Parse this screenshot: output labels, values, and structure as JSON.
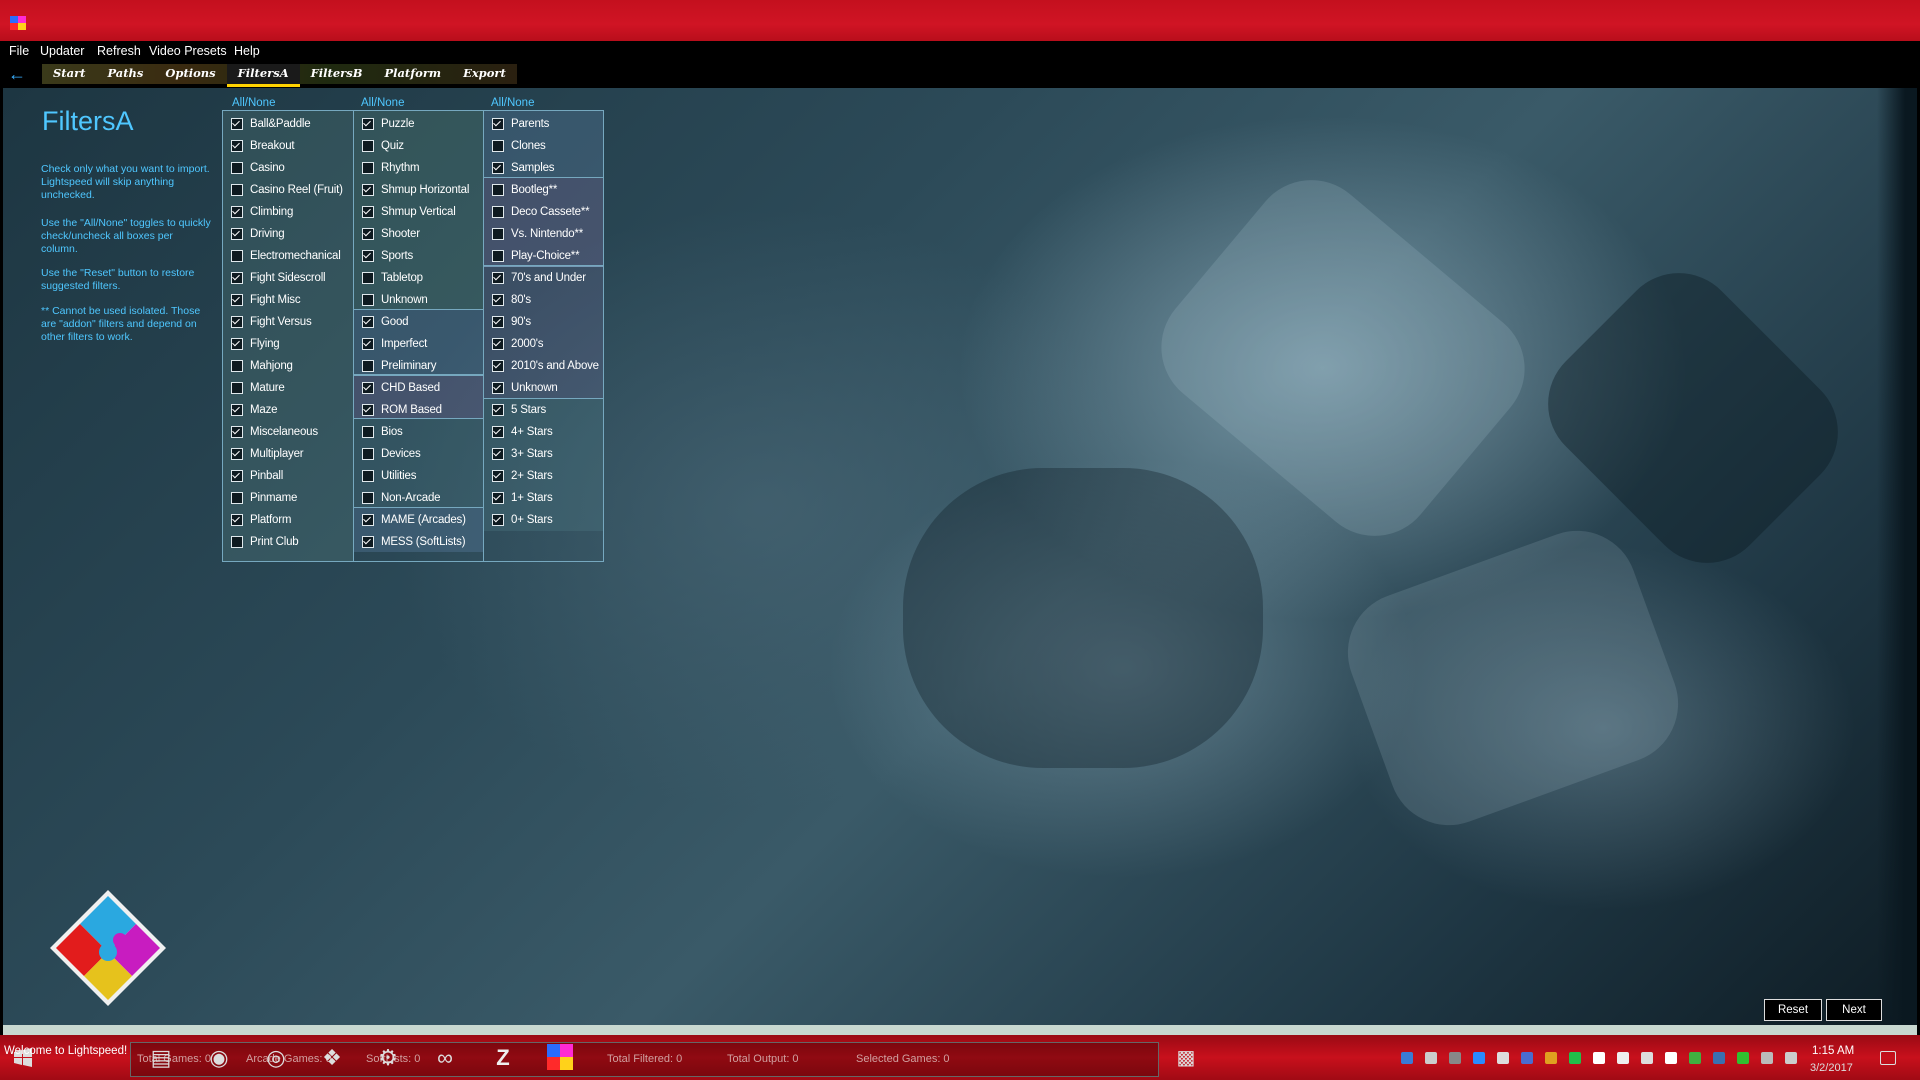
{
  "menu": [
    "File",
    "Updater",
    "Refresh",
    "Video Presets",
    "Help"
  ],
  "nav_tabs": [
    {
      "label": "Start",
      "active": false
    },
    {
      "label": "Paths",
      "active": false
    },
    {
      "label": "Options",
      "active": false
    },
    {
      "label": "FiltersA",
      "active": true
    },
    {
      "label": "FiltersB",
      "active": false
    },
    {
      "label": "Platform",
      "active": false
    },
    {
      "label": "Export",
      "active": false
    }
  ],
  "page": {
    "title": "FiltersA",
    "help": [
      "Check only what you want to import. Lightspeed will skip anything unchecked.",
      "Use the \"All/None\" toggles to quickly check/uncheck all boxes per column.",
      "Use the \"Reset\" button to restore suggested filters.",
      "** Cannot be used isolated. Those are \"addon\" filters and depend on other filters to work."
    ],
    "allnone_label": "All/None"
  },
  "columns": [
    {
      "items": [
        {
          "label": "Ball&Paddle",
          "checked": true
        },
        {
          "label": "Breakout",
          "checked": true
        },
        {
          "label": "Casino",
          "checked": false
        },
        {
          "label": "Casino Reel (Fruit)",
          "checked": false
        },
        {
          "label": "Climbing",
          "checked": true
        },
        {
          "label": "Driving",
          "checked": true
        },
        {
          "label": "Electromechanical",
          "checked": false
        },
        {
          "label": "Fight Sidescroll",
          "checked": true
        },
        {
          "label": "Fight Misc",
          "checked": true
        },
        {
          "label": "Fight Versus",
          "checked": true
        },
        {
          "label": "Flying",
          "checked": true
        },
        {
          "label": "Mahjong",
          "checked": false
        },
        {
          "label": "Mature",
          "checked": false
        },
        {
          "label": "Maze",
          "checked": true
        },
        {
          "label": "Miscelaneous",
          "checked": true
        },
        {
          "label": "Multiplayer",
          "checked": true
        },
        {
          "label": "Pinball",
          "checked": true
        },
        {
          "label": "Pinmame",
          "checked": false
        },
        {
          "label": "Platform",
          "checked": true
        },
        {
          "label": "Print Club",
          "checked": false
        }
      ]
    },
    {
      "items": [
        {
          "label": "Puzzle",
          "checked": true
        },
        {
          "label": "Quiz",
          "checked": false
        },
        {
          "label": "Rhythm",
          "checked": false
        },
        {
          "label": "Shmup Horizontal",
          "checked": true
        },
        {
          "label": "Shmup Vertical",
          "checked": true
        },
        {
          "label": "Shooter",
          "checked": true
        },
        {
          "label": "Sports",
          "checked": true
        },
        {
          "label": "Tabletop",
          "checked": false
        },
        {
          "label": "Unknown",
          "checked": false
        },
        {
          "label": "Good",
          "checked": true
        },
        {
          "label": "Imperfect",
          "checked": true
        },
        {
          "label": "Preliminary",
          "checked": false
        },
        {
          "label": "CHD Based",
          "checked": true
        },
        {
          "label": "ROM Based",
          "checked": true
        },
        {
          "label": "Bios",
          "checked": false
        },
        {
          "label": "Devices",
          "checked": false
        },
        {
          "label": "Utilities",
          "checked": false
        },
        {
          "label": "Non-Arcade",
          "checked": false
        },
        {
          "label": "MAME (Arcades)",
          "checked": true
        },
        {
          "label": "MESS (SoftLists)",
          "checked": true
        }
      ]
    },
    {
      "items": [
        {
          "label": "Parents",
          "checked": true
        },
        {
          "label": "Clones",
          "checked": false
        },
        {
          "label": "Samples",
          "checked": true
        },
        {
          "label": "Bootleg**",
          "checked": false
        },
        {
          "label": "Deco Cassete**",
          "checked": false
        },
        {
          "label": "Vs. Nintendo**",
          "checked": false
        },
        {
          "label": "Play-Choice**",
          "checked": false
        },
        {
          "label": "70's and Under",
          "checked": true
        },
        {
          "label": "80's",
          "checked": true
        },
        {
          "label": "90's",
          "checked": true
        },
        {
          "label": "2000's",
          "checked": true
        },
        {
          "label": "2010's and Above",
          "checked": true
        },
        {
          "label": "Unknown",
          "checked": true
        },
        {
          "label": "5 Stars",
          "checked": true
        },
        {
          "label": "4+ Stars",
          "checked": true
        },
        {
          "label": "3+ Stars",
          "checked": true
        },
        {
          "label": "2+ Stars",
          "checked": true
        },
        {
          "label": "1+ Stars",
          "checked": true
        },
        {
          "label": "0+ Stars",
          "checked": true
        }
      ]
    }
  ],
  "buttons": {
    "reset": "Reset",
    "next": "Next"
  },
  "status": {
    "welcome": "Welcome to Lightspeed!",
    "total_games": "Total Games: 0",
    "arcade_games": "Arcade Games: 0",
    "softlists": "SoftLists: 0",
    "total_filtered": "Total Filtered: 0",
    "total_output": "Total Output: 0",
    "selected_games": "Selected Games: 0"
  },
  "clock": {
    "time": "1:15 AM",
    "date": "3/2/2017"
  },
  "colors": {
    "accent": "#4fc7ff",
    "title_bar": "#d01424",
    "active_tab_underline": "#ffd200"
  }
}
